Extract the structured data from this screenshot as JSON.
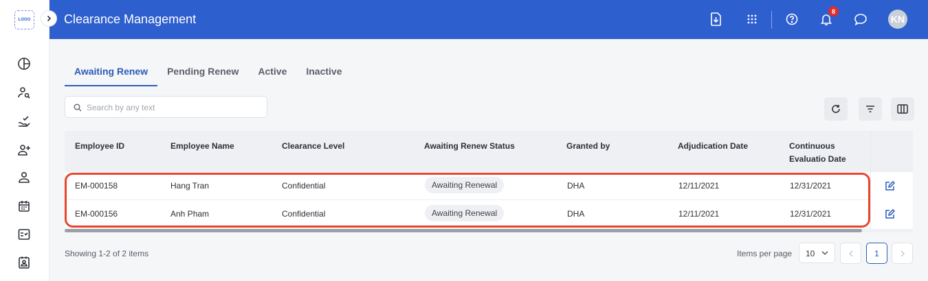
{
  "sidebar": {
    "logo_text": "LOGO",
    "items": [
      {
        "icon": "pie-chart-icon"
      },
      {
        "icon": "user-search-icon"
      },
      {
        "icon": "hand-check-icon"
      },
      {
        "icon": "user-add-icon"
      },
      {
        "icon": "user-icon"
      },
      {
        "icon": "calendar-icon"
      },
      {
        "icon": "checklist-icon"
      },
      {
        "icon": "id-badge-icon"
      }
    ]
  },
  "header": {
    "title": "Clearance Management",
    "notifications_count": "8",
    "avatar_initials": "KN",
    "color": "#2e5fce"
  },
  "tabs": [
    {
      "label": "Awaiting Renew",
      "active": true
    },
    {
      "label": "Pending Renew"
    },
    {
      "label": "Active"
    },
    {
      "label": "Inactive"
    }
  ],
  "search": {
    "placeholder": "Search by any text",
    "value": ""
  },
  "table": {
    "columns": [
      "Employee ID",
      "Employee Name",
      "Clearance Level",
      "Awaiting Renew Status",
      "Granted by",
      "Adjudication Date",
      "Continuous Evaluatio Date"
    ],
    "rows": [
      {
        "id": "EM-000158",
        "name": "Hang Tran",
        "level": "Confidential",
        "status": "Awaiting Renewal",
        "granted_by": "DHA",
        "adjudication": "12/11/2021",
        "evaluation": "12/31/2021"
      },
      {
        "id": "EM-000156",
        "name": "Anh Pham",
        "level": "Confidential",
        "status": "Awaiting Renewal",
        "granted_by": "DHA",
        "adjudication": "12/11/2021",
        "evaluation": "12/31/2021"
      }
    ]
  },
  "footer": {
    "showing": "Showing 1-2 of 2 items",
    "items_per_page_label": "Items per page",
    "items_per_page": "10",
    "current_page": "1"
  },
  "colors": {
    "accent": "#2a5bb8",
    "highlight": "#e8452c"
  }
}
